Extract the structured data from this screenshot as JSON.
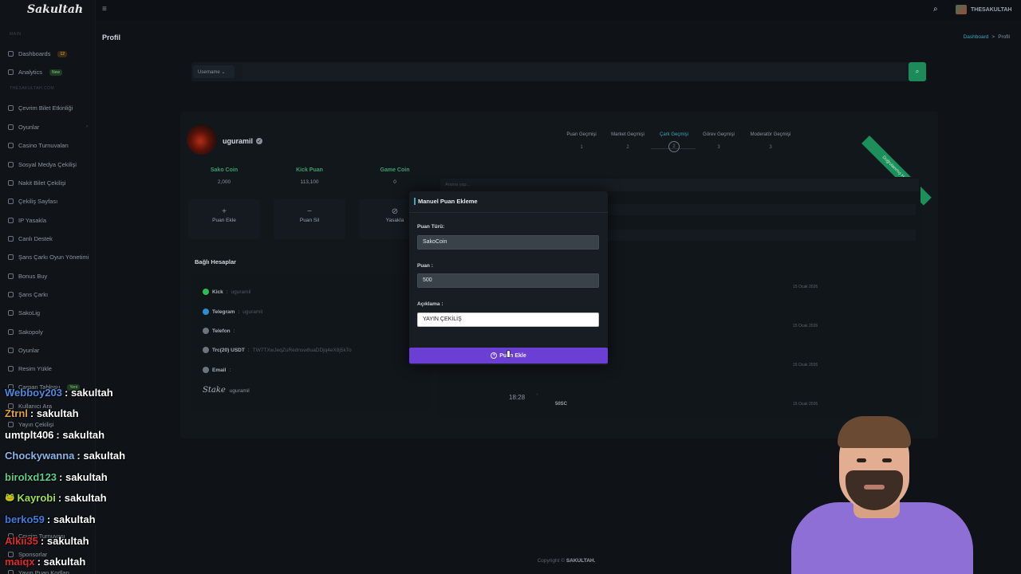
{
  "app": {
    "logo": "Sakultah",
    "page_title": "Profil"
  },
  "topbar": {
    "username": "THESAKULTAH"
  },
  "breadcrumb": {
    "items": [
      "Dashboard",
      "Profil"
    ],
    "separator": ">"
  },
  "sidebar": {
    "sections": [
      "MAIN",
      "THESAKULTAH.COM"
    ],
    "items": [
      {
        "label": "Dashboards",
        "badge": "12",
        "badge_color": "orange"
      },
      {
        "label": "Analytics",
        "badge": "New",
        "badge_color": "green"
      },
      {
        "label": "Çevrim Bilet Etkinliği"
      },
      {
        "label": "Oyunlar",
        "has_submenu": true
      },
      {
        "label": "Casino Turnuvaları"
      },
      {
        "label": "Sosyal Medya Çekilişi"
      },
      {
        "label": "Nakit Bilet Çekilişi"
      },
      {
        "label": "Çekiliş Sayfası"
      },
      {
        "label": "IP Yasakla"
      },
      {
        "label": "Canlı Destek"
      },
      {
        "label": "Şans Çarkı Oyun Yönetimi"
      },
      {
        "label": "Bonus Buy"
      },
      {
        "label": "Şans Çarkı"
      },
      {
        "label": "SakoLig"
      },
      {
        "label": "Sakopoly"
      },
      {
        "label": "Oyunlar"
      },
      {
        "label": "Resim Yükle"
      },
      {
        "label": "Carpan Tablosu",
        "badge": "Yeni",
        "badge_color": "green"
      },
      {
        "label": "Kullanıcı Ara"
      },
      {
        "label": "Yayın Çekilişi"
      },
      {
        "label": "Çevrim Turnuvası"
      },
      {
        "label": "Sponsorlar"
      },
      {
        "label": "Yayın Puan Kodları"
      }
    ]
  },
  "search": {
    "select_label": "Username"
  },
  "profile": {
    "username": "uguramil",
    "ribbon": "Doğrulanmış Hesap",
    "stats": [
      {
        "label": "Sako Coin",
        "value": "2,000"
      },
      {
        "label": "Kick Puan",
        "value": "113,100"
      },
      {
        "label": "Game Coin",
        "value": "0"
      }
    ],
    "actions": [
      {
        "symbol": "+",
        "label": "Puan Ekle"
      },
      {
        "symbol": "−",
        "label": "Puan Sil"
      },
      {
        "symbol": "⊘",
        "label": "Yasakla"
      }
    ],
    "linked_title": "Bağlı Hesaplar",
    "linked": [
      {
        "name": "Kick",
        "value": "uguramil",
        "icon": "kick-icon"
      },
      {
        "name": "Telegram",
        "value": "uguramil",
        "icon": "telegram-icon"
      },
      {
        "name": "Telefon",
        "value": "",
        "icon": "phone-icon"
      },
      {
        "name": "Trc(20) USDT",
        "value": "TW7TXwJeqZuRednsw8uaDDjq4eX8j5kTo",
        "icon": "usdt-icon"
      },
      {
        "name": "Email",
        "value": "",
        "icon": "email-icon"
      }
    ],
    "stake": {
      "brand": "Stake",
      "value": "uguramil"
    }
  },
  "history_tabs": [
    {
      "label": "Puan Geçmişi",
      "num": "1"
    },
    {
      "label": "Market Geçmişi",
      "num": "2"
    },
    {
      "label": "Çark Geçmişi",
      "num": "2",
      "active": true
    },
    {
      "label": "Görev Geçmişi",
      "num": "3"
    },
    {
      "label": "Moderatör Geçmişi",
      "num": "3"
    }
  ],
  "history": {
    "filter_placeholder": "Arama yap...",
    "dates": [
      "15 Ocak 2026",
      "15 Ocak 2026",
      "15 Ocak 2026",
      "15 Ocak 2026"
    ],
    "time": "18:28",
    "coin": "50SC"
  },
  "modal": {
    "title": "Manuel Puan Ekleme",
    "type_label": "Puan Türü:",
    "type_value": "SakoCoin",
    "amount_label": "Puan :",
    "amount_value": "500",
    "desc_label": "Açıklama :",
    "desc_value": "YAYIN ÇEKİLİŞ",
    "submit": "Puan Ekle"
  },
  "footer": {
    "prefix": "Copyright ©",
    "brand": "SAKULTAH."
  },
  "chat": [
    {
      "user": "Webboy203",
      "text": ": sakultah",
      "color": "#4f8be0"
    },
    {
      "user": "Ztrnl",
      "text": ": sakultah",
      "color": "#e0a13c"
    },
    {
      "user": "umtplt406",
      "text": ": sakultah",
      "color": "#ffffff"
    },
    {
      "user": "Chockywanna",
      "text": ": sakultah",
      "color": "#8ab6e8"
    },
    {
      "user": "birolxd123",
      "text": ": sakultah",
      "color": "#5fd08a"
    },
    {
      "user": "Kayrobi",
      "text": ": sakultah",
      "color": "#9be04f",
      "emote": "🐸"
    },
    {
      "user": "berko59",
      "text": ": sakultah",
      "color": "#3d7de0"
    },
    {
      "user": "Alkii35",
      "text": ": sakultah",
      "color": "#e02b2b"
    },
    {
      "user": "maiqx",
      "text": ": sakultah",
      "color": "#e02b2b"
    }
  ]
}
